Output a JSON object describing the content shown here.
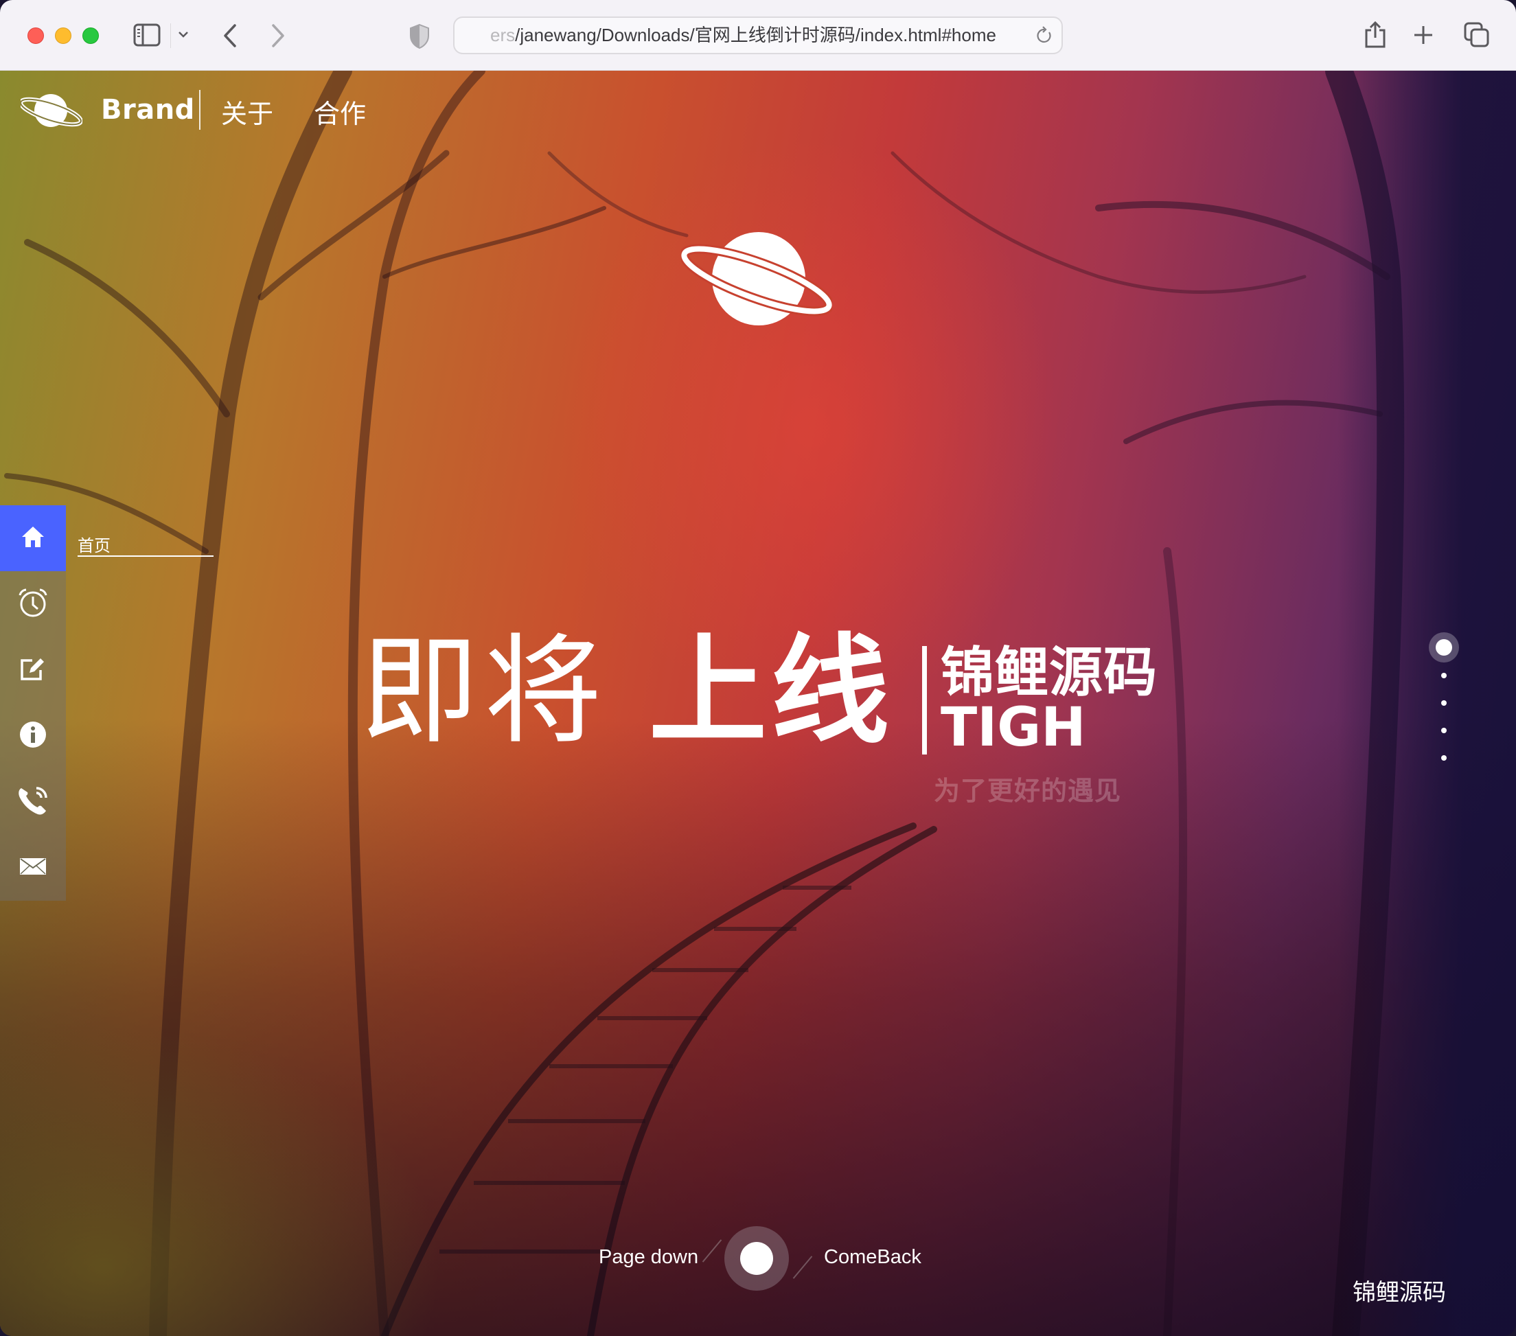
{
  "browser": {
    "url_faded": "ers",
    "url_main": "/janewang/Downloads/官网上线倒计时源码/index.html#home",
    "icons": [
      "sidebar-toggle-icon",
      "chevron-down-icon",
      "back-icon",
      "forward-icon",
      "shield-icon",
      "reload-icon",
      "share-icon",
      "new-tab-icon",
      "tabs-overview-icon"
    ]
  },
  "nav": {
    "brand": "Brand",
    "links": [
      {
        "label": "关于"
      },
      {
        "label": "合作"
      }
    ]
  },
  "sidebar": {
    "active_label": "首页",
    "items": [
      {
        "icon": "home-icon",
        "label": "首页",
        "active": true
      },
      {
        "icon": "alarm-clock-icon",
        "active": false
      },
      {
        "icon": "edit-icon",
        "active": false
      },
      {
        "icon": "info-icon",
        "active": false
      },
      {
        "icon": "phone-icon",
        "active": false
      },
      {
        "icon": "mail-icon",
        "active": false
      }
    ],
    "active_color": "#4a63ff"
  },
  "hero": {
    "light_text": "即将",
    "bold_text": "上线",
    "brand_cn": "锦鲤源码",
    "brand_en": "TIGH",
    "subtitle": "为了更好的遇见"
  },
  "section_dots": {
    "count": 5,
    "active_index": 0
  },
  "pager": {
    "prev_label": "Page down",
    "next_label": "ComeBack"
  },
  "footer": {
    "brand": "锦鲤源码"
  }
}
